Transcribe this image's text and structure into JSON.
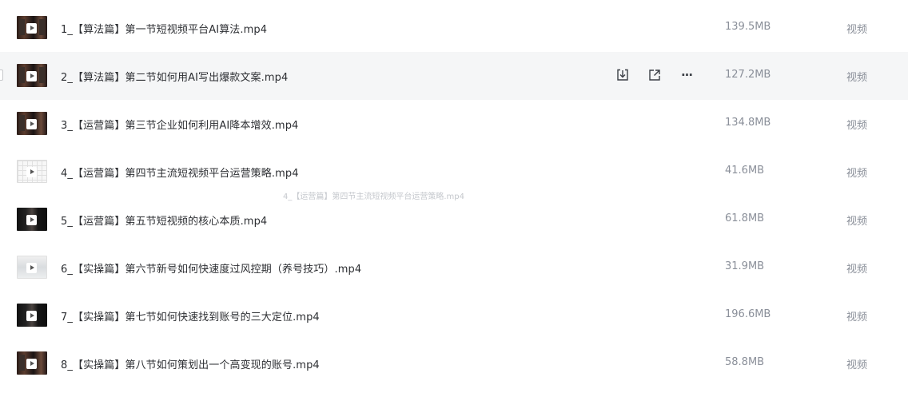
{
  "files": [
    {
      "name": "1_【算法篇】第一节短视频平台AI算法.mp4",
      "size": "139.5MB",
      "type": "视频",
      "thumb": "dark"
    },
    {
      "name": "2_【算法篇】第二节如何用AI写出爆款文案.mp4",
      "size": "127.2MB",
      "type": "视频",
      "thumb": "dark"
    },
    {
      "name": "3_【运营篇】第三节企业如何利用AI降本增效.mp4",
      "size": "134.8MB",
      "type": "视频",
      "thumb": "dark"
    },
    {
      "name": "4_【运营篇】第四节主流短视频平台运营策略.mp4",
      "size": "41.6MB",
      "type": "视频",
      "thumb": "grid"
    },
    {
      "name": "5_【运营篇】第五节短视频的核心本质.mp4",
      "size": "61.8MB",
      "type": "视频",
      "thumb": "black"
    },
    {
      "name": "6_【实操篇】第六节新号如何快速度过风控期（养号技巧）.mp4",
      "size": "31.9MB",
      "type": "视频",
      "thumb": "light"
    },
    {
      "name": "7_【实操篇】第七节如何快速找到账号的三大定位.mp4",
      "size": "196.6MB",
      "type": "视频",
      "thumb": "black"
    },
    {
      "name": "8_【实操篇】第八节如何策划出一个高变现的账号.mp4",
      "size": "58.8MB",
      "type": "视频",
      "thumb": "dark"
    }
  ],
  "hover_actions": {
    "download_icon": "download-icon",
    "share_icon": "share-icon",
    "more_label": "···"
  },
  "drag_ghost_text": "4_【运营篇】第四节主流短视频平台运营策略.mp4"
}
